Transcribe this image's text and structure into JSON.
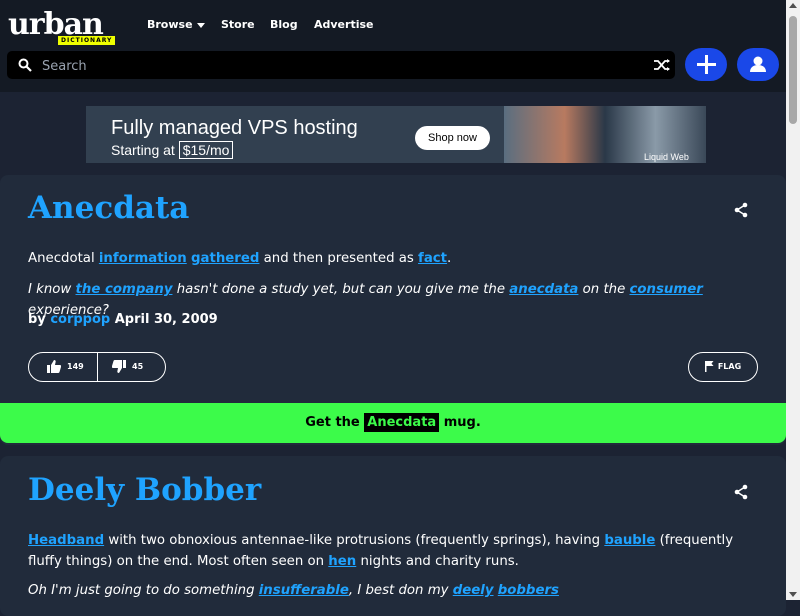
{
  "header": {
    "logo_text": "urban",
    "logo_tag": "DICTIONARY",
    "nav": {
      "browse": "Browse",
      "store": "Store",
      "blog": "Blog",
      "advertise": "Advertise"
    },
    "search_placeholder": "Search",
    "icons": [
      "search-icon",
      "shuffle-icon",
      "plus-icon",
      "user-icon"
    ]
  },
  "ad": {
    "title": "Fully managed VPS hosting",
    "sub_prefix": "Starting at",
    "price": "$15/mo",
    "button": "Shop now",
    "brand": "Liquid Web"
  },
  "entries": [
    {
      "word": "Anecdata",
      "meaning": [
        "Anecdotal ",
        "information",
        " ",
        "gathered",
        " and then presented as ",
        "fact",
        "."
      ],
      "example": [
        "I know ",
        "the company",
        " hasn't done a study yet, but can you give me the ",
        "anecdata",
        " on the ",
        "consumer",
        " experience?"
      ],
      "by_prefix": "by",
      "author": "corppop",
      "date": "April 30, 2009",
      "upvotes": "149",
      "downvotes": "45",
      "flag": "FLAG"
    },
    {
      "word": "Deely Bobber",
      "meaning": [
        "Headband",
        " with two obnoxious antennae-like protrusions (frequently springs), having ",
        "bauble",
        " (frequently fluffy things) on the end. Most often seen on ",
        "hen",
        " nights and charity runs."
      ],
      "example": [
        "Oh I'm just going to do something ",
        "insufferable",
        ", I best don my ",
        "deely",
        " ",
        "bobbers"
      ]
    }
  ],
  "mug": {
    "prefix": "Get the",
    "word": "Anecdata",
    "suffix": "mug."
  },
  "colors": {
    "accent": "#1fa3ff",
    "mug_bg": "#3cfb4a",
    "card_bg": "#212b3b",
    "page_bg": "#1c2333"
  }
}
